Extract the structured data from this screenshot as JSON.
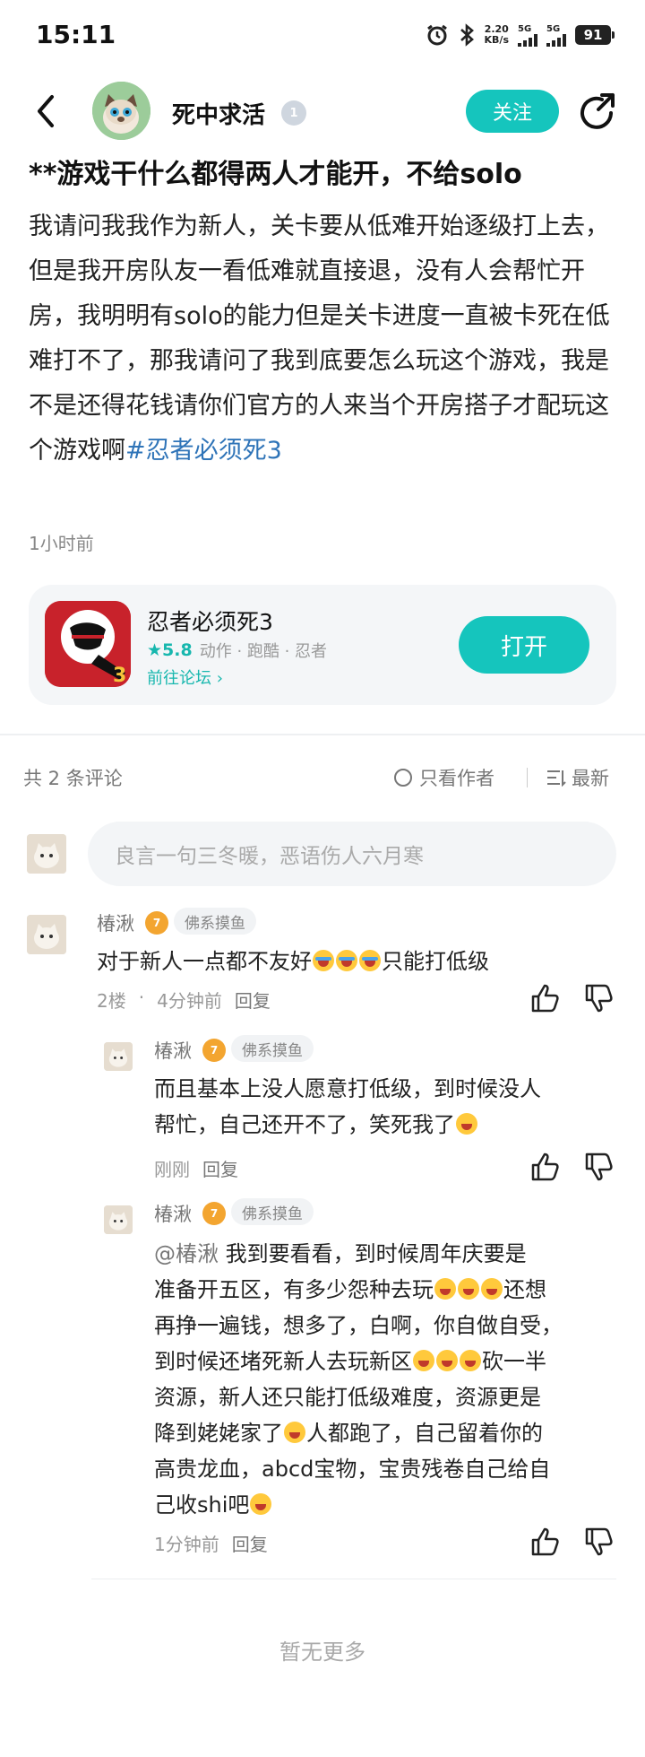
{
  "status_bar": {
    "time": "15:11",
    "net_speed": "2.20",
    "net_unit": "KB/s",
    "sim1": "5G",
    "sim2": "5G",
    "battery": "91"
  },
  "header": {
    "author": "死中求活",
    "level": "1",
    "follow_label": "关注"
  },
  "post": {
    "title": "**游戏干什么都得两人才能开，不给solo",
    "body": "我请问我我作为新人，关卡要从低难开始逐级打上去，但是我开房队友一看低难就直接退，没有人会帮忙开房，我明明有solo的能力但是关卡进度一直被卡死在低难打不了，那我请问了我到底要怎么玩这个游戏，我是不是还得花钱请你们官方的人来当个开房搭子才配玩这个游戏啊",
    "hashtag": "#忍者必须死3",
    "time": "1小时前"
  },
  "game_card": {
    "name": "忍者必须死3",
    "rating": "5.8",
    "tags": "动作 · 跑酷 · 忍者",
    "forum_link": "前往论坛",
    "open_label": "打开"
  },
  "comments_header": {
    "count": "共 2 条评论",
    "only_author": "只看作者",
    "sort": "最新"
  },
  "comment_input": {
    "placeholder": "良言一句三冬暖，恶语伤人六月寒"
  },
  "comments": [
    {
      "name": "椿湫",
      "level": "7",
      "tag": "佛系摸鱼",
      "text": "对于新人一点都不友好",
      "text_after": "只能打低级",
      "floor": "2楼",
      "time": "4分钟前",
      "reply": "回复"
    },
    {
      "name": "椿湫",
      "level": "7",
      "tag": "佛系摸鱼",
      "text_line1": "而且基本上没人愿意打低级，到时候没人",
      "text_line2": "帮忙，自己还开不了，笑死我了",
      "time": "刚刚",
      "reply": "回复"
    },
    {
      "name": "椿湫",
      "level": "7",
      "tag": "佛系摸鱼",
      "mention": "@椿湫",
      "l1": "我到要看看，到时候周年庆要是",
      "l2": "准备开五区，有多少怨种去玩",
      "l2b": "还想",
      "l3": "再挣一遍钱，想多了，白啊，你自做自受，",
      "l4": "到时候还堵死新人去玩新区",
      "l4b": "砍一半",
      "l5": "资源，新人还只能打低级难度，资源更是",
      "l6": "降到姥姥家了",
      "l6b": "人都跑了，自己留着你的",
      "l7": "高贵龙血，abcd宝物，宝贵残卷自己给自",
      "l8": "己收shi吧",
      "time": "1分钟前",
      "reply": "回复"
    }
  ],
  "footer": {
    "no_more": "暂无更多"
  },
  "colors": {
    "accent": "#15c5bd",
    "hashtag": "#2f74b8",
    "level_badge": "#f3a530"
  }
}
